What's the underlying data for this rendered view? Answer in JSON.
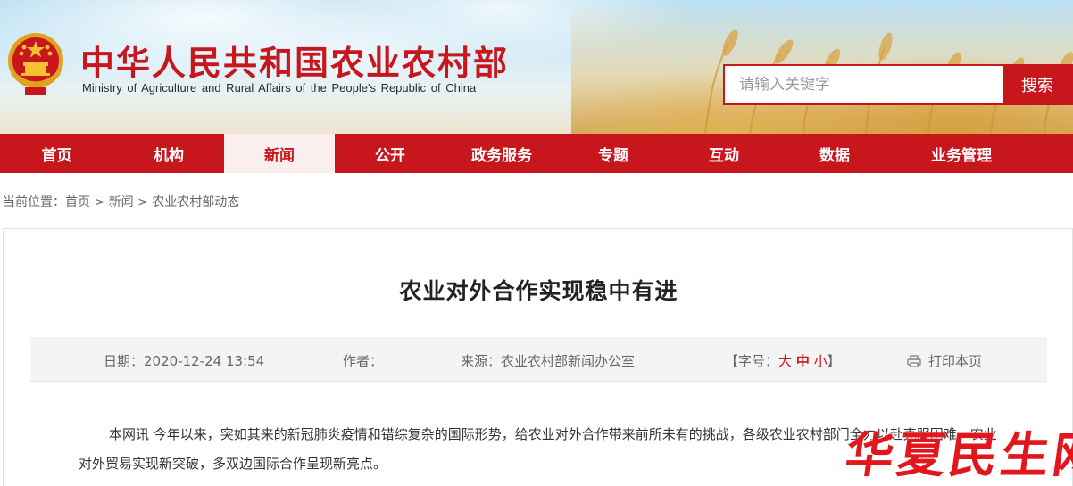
{
  "header": {
    "title": "中华人民共和国农业农村部",
    "subtitle": "Ministry of Agriculture and Rural Affairs of the People's Republic of China",
    "emblem_icon": "national-emblem-icon",
    "search": {
      "placeholder": "请输入关键字",
      "button_label": "搜索"
    }
  },
  "nav": {
    "items": [
      {
        "label": "首页",
        "active": false
      },
      {
        "label": "机构",
        "active": false
      },
      {
        "label": "新闻",
        "active": true
      },
      {
        "label": "公开",
        "active": false
      },
      {
        "label": "政务服务",
        "active": false
      },
      {
        "label": "专题",
        "active": false
      },
      {
        "label": "互动",
        "active": false
      },
      {
        "label": "数据",
        "active": false
      },
      {
        "label": "业务管理",
        "active": false
      }
    ]
  },
  "breadcrumb": {
    "prefix": "当前位置：",
    "items": [
      "首页",
      "新闻",
      "农业农村部动态"
    ],
    "separator": " > "
  },
  "article": {
    "title": "农业对外合作实现稳中有进",
    "meta": {
      "date": "日期：2020-12-24 13:54",
      "author": "作者：",
      "source": "来源：农业农村部新闻办公室",
      "font_size_open": "【字号：",
      "font_large": "大",
      "font_medium": "中",
      "font_small": "小",
      "font_size_close": "】",
      "print_label": "打印本页",
      "print_icon": "printer-icon"
    },
    "body": "本网讯 今年以来，突如其来的新冠肺炎疫情和错综复杂的国际形势，给农业对外合作带来前所未有的挑战，各级农业农村部门全力以赴克服困难，农业对外贸易实现新突破，多双边国际合作呈现新亮点。"
  },
  "watermark": {
    "text": "华夏民生网"
  },
  "colors": {
    "brand_red": "#c8161d",
    "nav_active_bg": "#fbeeee",
    "meta_bg": "#f4f4f4"
  }
}
